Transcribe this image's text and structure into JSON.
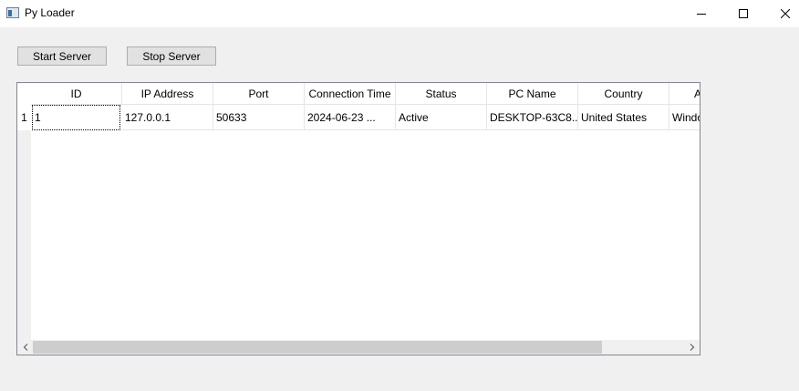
{
  "window": {
    "title": "Py Loader",
    "icon": "app-window-icon",
    "controls": [
      "minimize-icon",
      "maximize-icon",
      "close-icon"
    ]
  },
  "toolbar": {
    "start_label": "Start Server",
    "stop_label": "Stop Server"
  },
  "table": {
    "columns": [
      "ID",
      "IP Address",
      "Port",
      "Connection Time",
      "Status",
      "PC Name",
      "Country",
      "A"
    ],
    "rows": [
      {
        "row_number": "1",
        "cells": [
          "1",
          "127.0.0.1",
          "50633",
          "2024-06-23 ...",
          "Active",
          "DESKTOP-63C8...",
          "United States",
          "Windo"
        ]
      }
    ],
    "scroll_icons": [
      "chevron-left-icon",
      "chevron-right-icon"
    ]
  },
  "colors": {
    "background": "#f0f0f0",
    "button_face": "#e1e1e1",
    "grid_line": "#e5e5e5",
    "table_border": "#828790"
  }
}
